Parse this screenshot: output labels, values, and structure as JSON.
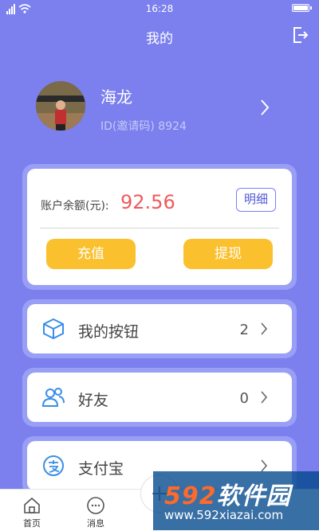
{
  "status_bar": {
    "time": "16:28"
  },
  "header": {
    "title": "我的"
  },
  "profile": {
    "name": "海龙",
    "id_label": "ID(邀请码) 8924"
  },
  "balance": {
    "label": "账户余额(元):",
    "value": "92.56",
    "detail_label": "明细",
    "recharge_label": "充值",
    "withdraw_label": "提现"
  },
  "menu": [
    {
      "label": "我的按钮",
      "count": "2",
      "icon": "cube-icon"
    },
    {
      "label": "好友",
      "count": "0",
      "icon": "friends-icon"
    },
    {
      "label": "支付宝",
      "count": "",
      "icon": "alipay-icon"
    }
  ],
  "tabs": [
    {
      "label": "首页",
      "icon": "home-icon"
    },
    {
      "label": "消息",
      "icon": "message-icon"
    }
  ],
  "watermark": {
    "brand_num": "592",
    "brand_text": "软件园",
    "url": "www.592xiazai.com"
  },
  "colors": {
    "background": "#7b80ee",
    "accent": "#fbc02d",
    "balance": "#f05a5a"
  }
}
